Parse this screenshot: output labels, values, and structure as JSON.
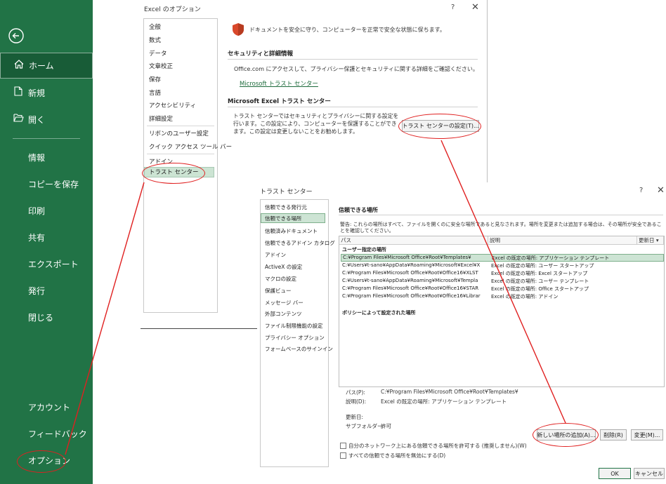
{
  "backstage": {
    "back_icon": "back-arrow-icon",
    "items": [
      {
        "label": "ホーム",
        "icon": "home-icon"
      },
      {
        "label": "新規",
        "icon": "new-document-icon"
      },
      {
        "label": "開く",
        "icon": "open-folder-icon"
      },
      {
        "label": "情報"
      },
      {
        "label": "コピーを保存"
      },
      {
        "label": "印刷"
      },
      {
        "label": "共有"
      },
      {
        "label": "エクスポート"
      },
      {
        "label": "発行"
      },
      {
        "label": "閉じる"
      },
      {
        "label": "アカウント"
      },
      {
        "label": "フィードバック"
      },
      {
        "label": "オプション"
      }
    ],
    "selected": "ホーム",
    "accent": "#217346"
  },
  "options_dialog": {
    "title": "Excel のオプション",
    "help_label": "?",
    "close_label": "✕",
    "nav": [
      "全般",
      "数式",
      "データ",
      "文章校正",
      "保存",
      "言語",
      "アクセシビリティ",
      "詳細設定",
      "リボンのユーザー設定",
      "クイック アクセス ツール バー",
      "アドイン",
      "トラスト センター"
    ],
    "selected_nav": "トラスト センター",
    "banner": "ドキュメントを安全に守り、コンピューターを正常で安全な状態に保ちます。",
    "security_heading": "セキュリティと詳細情報",
    "security_text": "Office.com にアクセスして、プライバシー保護とセキュリティに関する詳細をご確認ください。",
    "security_link": "Microsoft トラスト センター",
    "trust_heading": "Microsoft Excel トラスト センター",
    "trust_text": "トラスト センターではセキュリティとプライバシーに関する設定を行います。この設定により、コンピューターを保護することができます。この設定は変更しないことをお勧めします。",
    "trust_button": "トラスト センターの設定(T)..."
  },
  "trust_center": {
    "title": "トラスト センター",
    "help_label": "?",
    "close_label": "✕",
    "nav": [
      "信頼できる発行元",
      "信頼できる場所",
      "信頼済みドキュメント",
      "信頼できるアドイン カタログ",
      "アドイン",
      "ActiveX の設定",
      "マクロの設定",
      "保護ビュー",
      "メッセージ バー",
      "外部コンテンツ",
      "ファイル制限機能の設定",
      "プライバシー オプション",
      "フォームベースのサインイン"
    ],
    "selected_nav": "信頼できる場所",
    "heading": "信頼できる場所",
    "warning": "警告: これらの場所はすべて、ファイルを開くのに安全な場所であると見なされます。場所を変更または追加する場合は、その場所が安全であることを確認してください。",
    "columns": {
      "path": "パス",
      "description": "説明",
      "modified": "更新日 ▾"
    },
    "user_group": "ユーザー指定の場所",
    "rows": [
      {
        "path": "C:¥Program Files¥Microsoft Office¥Root¥Templates¥",
        "desc": "Excel の既定の場所: アプリケーション テンプレート"
      },
      {
        "path": "C:¥Users¥t-sano¥AppData¥Roaming¥Microsoft¥Excel¥X",
        "desc": "Excel の既定の場所: ユーザー スタートアップ"
      },
      {
        "path": "C:¥Program Files¥Microsoft Office¥Root¥Office16¥XLST",
        "desc": "Excel の既定の場所: Excel スタートアップ"
      },
      {
        "path": "C:¥Users¥t-sano¥AppData¥Roaming¥Microsoft¥Templa",
        "desc": "Excel の既定の場所: ユーザー テンプレート"
      },
      {
        "path": "C:¥Program Files¥Microsoft Office¥Root¥Office16¥STAR",
        "desc": "Excel の既定の場所: Office スタートアップ"
      },
      {
        "path": "C:¥Program Files¥Microsoft Office¥Root¥Office16¥Librar",
        "desc": "Excel の既定の場所: アドイン"
      }
    ],
    "policy_group": "ポリシーによって設定された場所",
    "details": {
      "path_label": "パス(P):",
      "path_value": "C:¥Program Files¥Microsoft Office¥Root¥Templates¥",
      "desc_label": "説明(D):",
      "desc_value": "Excel の既定の場所: アプリケーション テンプレート",
      "updated_label": "更新日:",
      "subfolder_label": "サブフォルダー:",
      "subfolder_value": "許可"
    },
    "buttons": {
      "add": "新しい場所の追加(A)...",
      "remove": "削除(R)",
      "modify": "変更(M)...",
      "ok": "OK",
      "cancel": "キャンセル"
    },
    "checkbox_network": "自分のネットワーク上にある信頼できる場所を許可する (推奨しません)(W)",
    "checkbox_disable": "すべての信頼できる場所を無効にする(D)"
  }
}
